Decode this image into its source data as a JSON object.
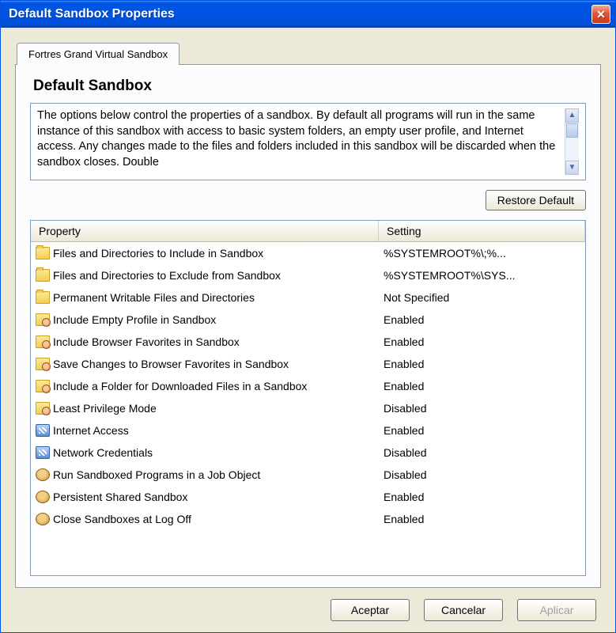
{
  "window": {
    "title": "Default Sandbox Properties"
  },
  "tab": {
    "label": "Fortres Grand Virtual Sandbox"
  },
  "heading": "Default Sandbox",
  "description": "The options below control the properties of a sandbox.  By default all programs will run in the same instance of this sandbox with access to basic system folders, an empty user profile, and Internet access.  Any changes made to the files and folders included in this sandbox will be discarded when the sandbox closes.  Double",
  "buttons": {
    "restore": "Restore Default",
    "ok": "Aceptar",
    "cancel": "Cancelar",
    "apply": "Aplicar"
  },
  "columns": {
    "property": "Property",
    "setting": "Setting"
  },
  "rows": [
    {
      "icon": "folder",
      "label": "Files and Directories to Include in Sandbox",
      "value": "%SYSTEMROOT%\\;%..."
    },
    {
      "icon": "folder",
      "label": "Files and Directories to Exclude from Sandbox",
      "value": "%SYSTEMROOT%\\SYS..."
    },
    {
      "icon": "folder",
      "label": "Permanent Writable Files and Directories",
      "value": "Not Specified"
    },
    {
      "icon": "folder-user",
      "label": "Include Empty Profile in Sandbox",
      "value": "Enabled"
    },
    {
      "icon": "folder-user",
      "label": "Include Browser Favorites in Sandbox",
      "value": "Enabled"
    },
    {
      "icon": "folder-user",
      "label": "Save Changes to Browser Favorites in Sandbox",
      "value": "Enabled"
    },
    {
      "icon": "folder-user",
      "label": "Include a Folder for Downloaded Files in a Sandbox",
      "value": "Enabled"
    },
    {
      "icon": "folder-user",
      "label": "Least Privilege Mode",
      "value": "Disabled"
    },
    {
      "icon": "net",
      "label": "Internet Access",
      "value": "Enabled"
    },
    {
      "icon": "net",
      "label": "Network Credentials",
      "value": "Disabled"
    },
    {
      "icon": "gear",
      "label": "Run Sandboxed Programs in a Job Object",
      "value": "Disabled"
    },
    {
      "icon": "gear",
      "label": "Persistent Shared Sandbox",
      "value": "Enabled"
    },
    {
      "icon": "gear",
      "label": "Close Sandboxes at Log Off",
      "value": "Enabled"
    }
  ]
}
